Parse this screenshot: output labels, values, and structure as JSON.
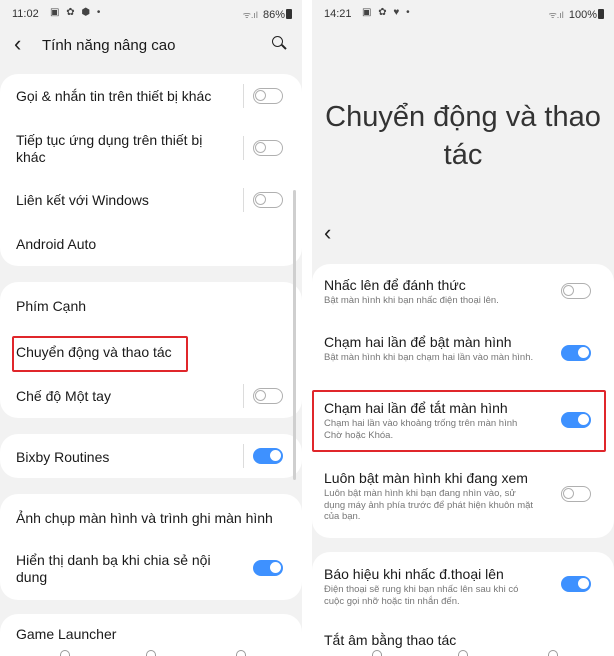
{
  "left": {
    "status": {
      "time": "11:02",
      "icons": "▣ ✿ ⬢ •",
      "signal": "ᯤ.ıl",
      "battery": "86%"
    },
    "header": {
      "title": "Tính năng nâng cao"
    },
    "group1": [
      {
        "label": "Gọi & nhắn tin trên thiết bị khác",
        "toggle": false
      },
      {
        "label": "Tiếp tục ứng dụng trên thiết bị khác",
        "toggle": false
      },
      {
        "label": "Liên kết với Windows",
        "toggle": false
      },
      {
        "label": "Android Auto"
      }
    ],
    "group2": [
      {
        "label": "Phím Cạnh"
      },
      {
        "label": "Chuyển động và thao tác"
      },
      {
        "label": "Chế độ Một tay",
        "toggle": false
      }
    ],
    "group3": [
      {
        "label": "Bixby Routines",
        "toggle": true
      }
    ],
    "group4": [
      {
        "label": "Ảnh chụp màn hình và trình ghi màn hình"
      },
      {
        "label": "Hiển thị danh bạ khi chia sẻ nội dung",
        "toggle": true
      }
    ],
    "group5": [
      {
        "label": "Game Launcher"
      }
    ]
  },
  "right": {
    "status": {
      "time": "14:21",
      "icons": "▣ ✿ ♥ •",
      "signal": "ᯤ.ıl",
      "battery": "100%"
    },
    "title": "Chuyển động và thao tác",
    "items": [
      {
        "title": "Nhấc lên để đánh thức",
        "desc": "Bật màn hình khi bạn nhấc điện thoại lên.",
        "toggle": false
      },
      {
        "title": "Chạm hai lần để bật màn hình",
        "desc": "Bật màn hình khi bạn chạm hai lần vào màn hình.",
        "toggle": true
      },
      {
        "title": "Chạm hai lần để tắt màn hình",
        "desc": "Chạm hai lần vào khoảng trống trên màn hình Chờ hoặc Khóa.",
        "toggle": true
      },
      {
        "title": "Luôn bật màn hình khi đang xem",
        "desc": "Luôn bật màn hình khi bạn đang nhìn vào, sử dụng máy ảnh phía trước để phát hiện khuôn mặt của bạn.",
        "toggle": false
      },
      {
        "title": "Báo hiệu khi nhấc đ.thoại lên",
        "desc": "Điện thoại sẽ rung khi bạn nhấc lên sau khi có cuộc gọi nhỡ hoặc tin nhắn đến.",
        "toggle": true
      },
      {
        "title": "Tắt âm bằng thao tác"
      }
    ]
  },
  "colors": {
    "accent": "#3e91ff",
    "highlight": "#e0262b",
    "background": "#f2f2f2"
  }
}
